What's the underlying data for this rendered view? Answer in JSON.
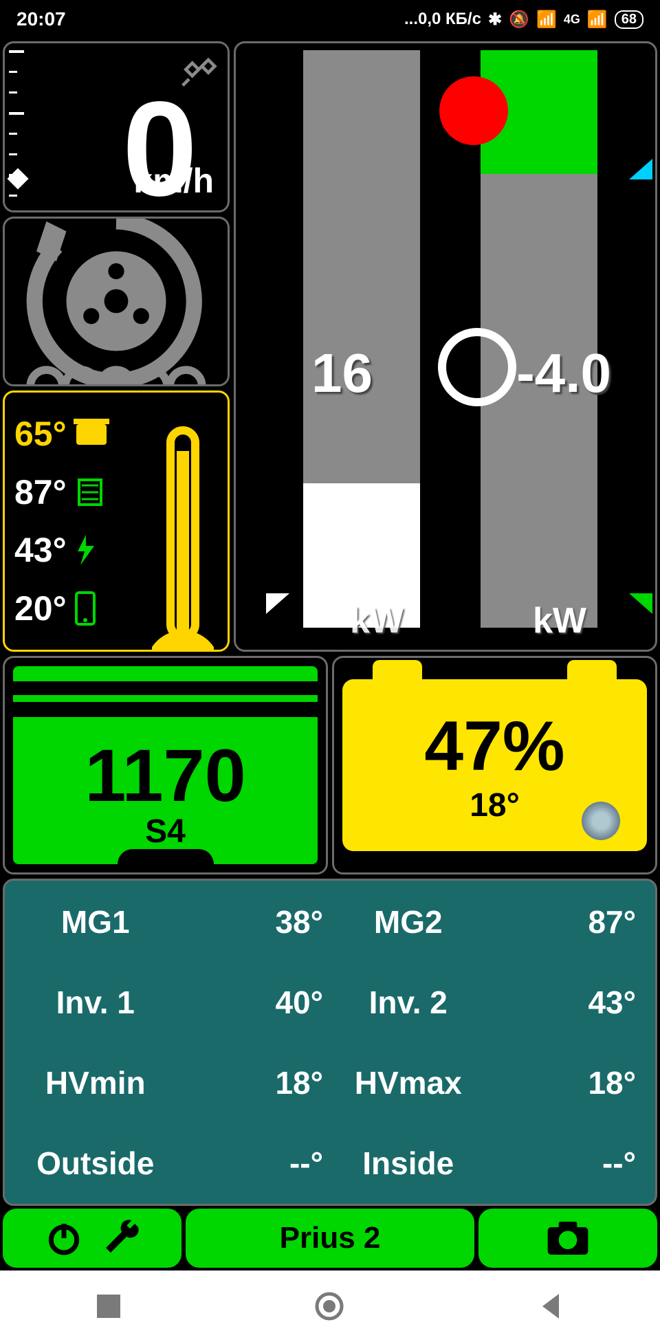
{
  "status": {
    "time": "20:07",
    "data_rate": "...0,0 КБ/с",
    "battery": "68"
  },
  "speed": {
    "value": "0",
    "unit": "km/h"
  },
  "temps": {
    "engine": "65°",
    "mg2": "87°",
    "inverter": "43°",
    "phone": "20°"
  },
  "power": {
    "left_value": "16",
    "right_value": "-4.0",
    "unit_left": "kW",
    "unit_right": "kW"
  },
  "rpm": {
    "value": "1170",
    "gear": "S4"
  },
  "soc": {
    "percent": "47%",
    "temp": "18°"
  },
  "grid": {
    "mg1_label": "MG1",
    "mg1_val": "38°",
    "mg2_label": "MG2",
    "mg2_val": "87°",
    "inv1_label": "Inv. 1",
    "inv1_val": "40°",
    "inv2_label": "Inv. 2",
    "inv2_val": "43°",
    "hvmin_label": "HVmin",
    "hvmin_val": "18°",
    "hvmax_label": "HVmax",
    "hvmax_val": "18°",
    "outside_label": "Outside",
    "outside_val": "--°",
    "inside_label": "Inside",
    "inside_val": "--°"
  },
  "bottom": {
    "vehicle": "Prius 2"
  }
}
